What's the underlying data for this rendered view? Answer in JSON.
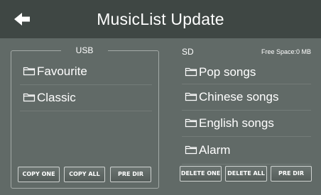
{
  "header": {
    "title": "MusicList Update",
    "back_icon": "arrow-left-icon"
  },
  "usb": {
    "title": "USB",
    "items": [
      {
        "icon": "folder-icon",
        "label": "Favourite"
      },
      {
        "icon": "folder-icon",
        "label": "Classic"
      }
    ],
    "buttons": {
      "copy_one": "COPY ONE",
      "copy_all": "COPY ALL",
      "pre_dir": "PRE DIR"
    }
  },
  "sd": {
    "title": "SD",
    "free_space": "Free Space:0 MB",
    "items": [
      {
        "icon": "folder-icon",
        "label": "Pop songs"
      },
      {
        "icon": "folder-icon",
        "label": "Chinese songs"
      },
      {
        "icon": "folder-icon",
        "label": "English songs"
      },
      {
        "icon": "folder-icon",
        "label": "Alarm"
      }
    ],
    "buttons": {
      "delete_one": "DELETE ONE",
      "delete_all": "DELETE ALL",
      "pre_dir": "PRE DIR"
    }
  },
  "colors": {
    "background": "#616a67",
    "header": "#3f4744",
    "text": "#ffffff"
  }
}
